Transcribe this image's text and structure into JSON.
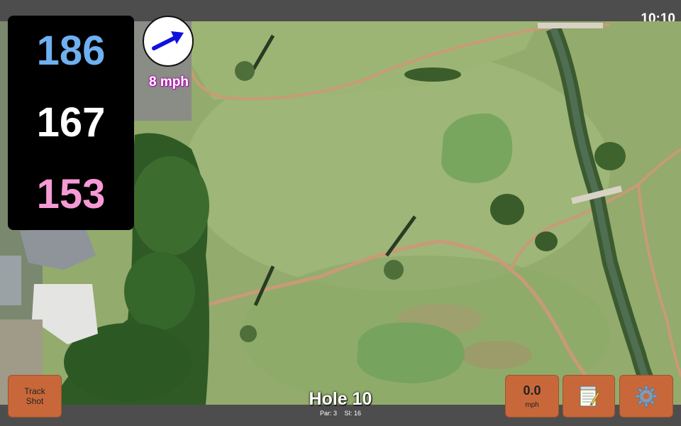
{
  "status": {
    "time": "10:10"
  },
  "distances": {
    "back": "186",
    "center": "167",
    "front": "153",
    "colors": {
      "back": "#6fb0f0",
      "center": "#ffffff",
      "front": "#f59ad4"
    }
  },
  "wind": {
    "speed_label": "8 mph",
    "arrow_color": "#1010e0",
    "direction": "east-northeast"
  },
  "buttons": {
    "track_shot": "Track Shot",
    "speed_value": "0.0",
    "speed_unit": "mph",
    "notes_icon": "notepad-icon",
    "settings_icon": "gear-icon",
    "accent": "#c8683a"
  },
  "hole": {
    "title": "Hole 10",
    "par": "Par: 3",
    "si": "SI: 16"
  }
}
